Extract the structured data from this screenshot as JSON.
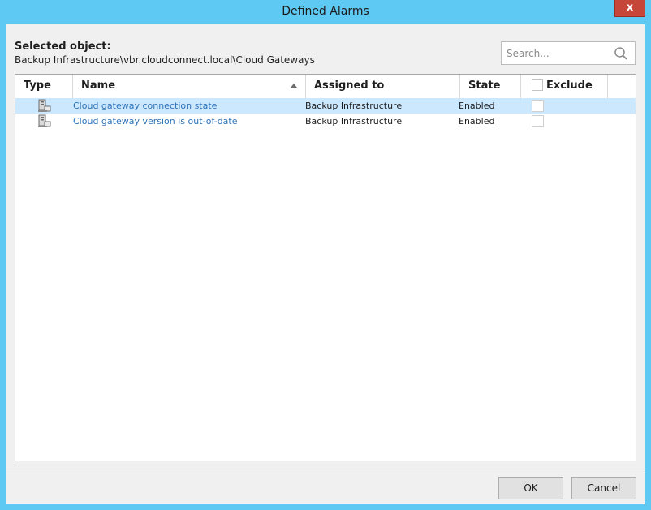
{
  "window": {
    "title": "Defined Alarms",
    "close_label": "x"
  },
  "selected_object": {
    "label": "Selected object:",
    "path": "Backup Infrastructure\\vbr.cloudconnect.local\\Cloud Gateways"
  },
  "search": {
    "placeholder": "Search...",
    "value": "",
    "icon": "magnifier-icon"
  },
  "table": {
    "columns": {
      "type": "Type",
      "name": "Name",
      "assigned": "Assigned to",
      "state": "State",
      "exclude": "Exclude"
    },
    "sort": {
      "column": "name",
      "direction": "ascending"
    },
    "rows": [
      {
        "icon": "alarm-server-icon",
        "name": "Cloud gateway connection state",
        "assigned": "Backup Infrastructure",
        "state": "Enabled",
        "exclude": false,
        "selected": true
      },
      {
        "icon": "alarm-server-icon",
        "name": "Cloud gateway version is out-of-date",
        "assigned": "Backup Infrastructure",
        "state": "Enabled",
        "exclude": false,
        "selected": false
      }
    ]
  },
  "buttons": {
    "ok": "OK",
    "cancel": "Cancel"
  },
  "colors": {
    "frame": "#5ec9f2",
    "close": "#c7463a",
    "selection": "#cce8ff",
    "link": "#2e73b8"
  }
}
